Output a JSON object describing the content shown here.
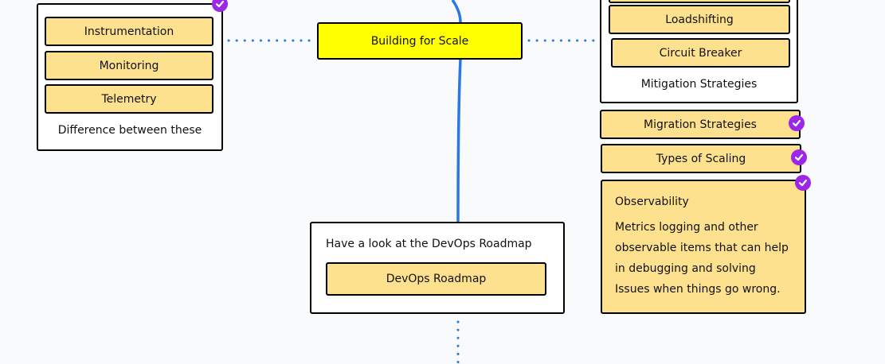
{
  "colors": {
    "accent_line": "#2b78e4",
    "topic_fill": "#ffff00",
    "node_fill": "#fee18e",
    "check": "#9c27e8"
  },
  "topic": {
    "label": "Building for Scale"
  },
  "left_group": {
    "items": [
      "Instrumentation",
      "Monitoring",
      "Telemetry"
    ],
    "label": "Difference between these"
  },
  "right_group": {
    "items": [
      "Loadshifting",
      "Circuit Breaker"
    ],
    "label": "Mitigation Strategies"
  },
  "right_nodes": {
    "migration": "Migration Strategies",
    "scaling": "Types of Scaling"
  },
  "observability": {
    "title": "Observability",
    "lines": [
      "Metrics logging and other",
      "observable items that can help",
      "in debugging and solving",
      "Issues when things go wrong."
    ]
  },
  "devops": {
    "text": "Have a look at the DevOps Roadmap",
    "button": "DevOps Roadmap"
  },
  "icons": {
    "done": "check-circle-icon"
  }
}
